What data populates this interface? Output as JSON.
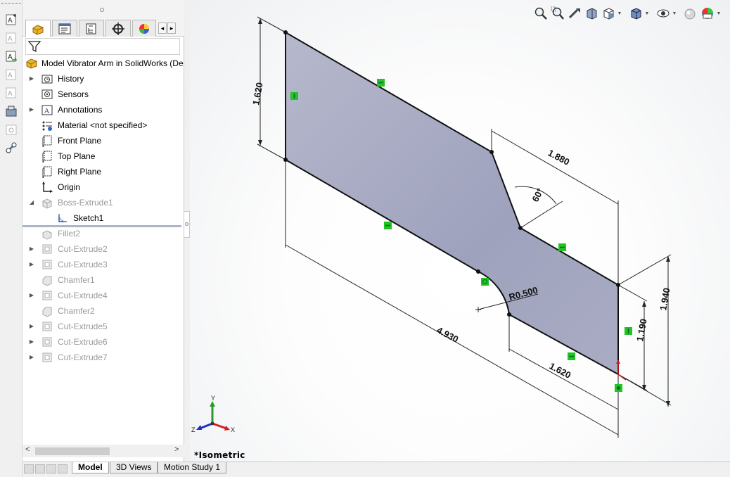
{
  "feature_tree": {
    "filter_icon": "filter-icon",
    "root_label": "Model Vibrator Arm in SolidWorks  (De",
    "items": [
      {
        "label": "History",
        "icon": "history-folder-icon",
        "expandable": true,
        "greyed": false
      },
      {
        "label": "Sensors",
        "icon": "sensors-icon",
        "expandable": false,
        "greyed": false
      },
      {
        "label": "Annotations",
        "icon": "annotations-icon",
        "expandable": true,
        "greyed": false
      },
      {
        "label": "Material <not specified>",
        "icon": "material-icon",
        "expandable": false,
        "greyed": false
      },
      {
        "label": "Front Plane",
        "icon": "plane-icon",
        "expandable": false,
        "greyed": false
      },
      {
        "label": "Top Plane",
        "icon": "plane-icon",
        "expandable": false,
        "greyed": false
      },
      {
        "label": "Right Plane",
        "icon": "plane-icon",
        "expandable": false,
        "greyed": false
      },
      {
        "label": "Origin",
        "icon": "origin-icon",
        "expandable": false,
        "greyed": false
      },
      {
        "label": "Boss-Extrude1",
        "icon": "boss-extrude-icon",
        "expandable": true,
        "expanded": true,
        "greyed": true
      },
      {
        "label": "Sketch1",
        "icon": "sketch-icon",
        "expandable": false,
        "greyed": false,
        "child": true
      },
      {
        "label": "Fillet2",
        "icon": "fillet-icon",
        "expandable": false,
        "greyed": true
      },
      {
        "label": "Cut-Extrude2",
        "icon": "cut-extrude-icon",
        "expandable": true,
        "greyed": true
      },
      {
        "label": "Cut-Extrude3",
        "icon": "cut-extrude-icon",
        "expandable": true,
        "greyed": true
      },
      {
        "label": "Chamfer1",
        "icon": "chamfer-icon",
        "expandable": false,
        "greyed": true
      },
      {
        "label": "Cut-Extrude4",
        "icon": "cut-extrude-icon",
        "expandable": true,
        "greyed": true
      },
      {
        "label": "Chamfer2",
        "icon": "chamfer-icon",
        "expandable": false,
        "greyed": true
      },
      {
        "label": "Cut-Extrude5",
        "icon": "cut-extrude-icon",
        "expandable": true,
        "greyed": true
      },
      {
        "label": "Cut-Extrude6",
        "icon": "cut-extrude-icon",
        "expandable": true,
        "greyed": true
      },
      {
        "label": "Cut-Extrude7",
        "icon": "cut-extrude-icon",
        "expandable": true,
        "greyed": true
      }
    ]
  },
  "panel_tabs": [
    {
      "name": "featuremanager-tab",
      "icon": "feature-manager-icon",
      "active": true
    },
    {
      "name": "propertymanager-tab",
      "icon": "property-manager-icon",
      "active": false
    },
    {
      "name": "configurationmanager-tab",
      "icon": "configuration-manager-icon",
      "active": false
    },
    {
      "name": "dimxpert-tab",
      "icon": "dimxpert-icon",
      "active": false
    },
    {
      "name": "display-manager-tab",
      "icon": "display-manager-icon",
      "active": false
    }
  ],
  "bottom_tabs": {
    "model": "Model",
    "views_3d": "3D Views",
    "motion_study": "Motion Study 1"
  },
  "viewport": {
    "view_label": "*Isometric",
    "sketch_fill": "#a6a9c2",
    "relation_color": "#22c322",
    "dimensions": {
      "d1": "1.620",
      "d2": "1.880",
      "angle": "60°",
      "radius": "R0.500",
      "d3": "4.930",
      "d4": "1.620",
      "d5": "1.190",
      "d6": "1.940"
    },
    "triad": {
      "x": "X",
      "y": "Y",
      "z": "Z"
    }
  },
  "heads_up_toolbar": [
    "zoom-to-fit-icon",
    "zoom-to-area-icon",
    "previous-view-icon",
    "section-view-icon",
    "view-orientation-icon",
    "display-style-icon",
    "hide-show-items-icon",
    "edit-appearance-icon",
    "apply-scene-icon"
  ],
  "left_strip": [
    "smart-dimension-icon",
    "note-icon",
    "auto-dimension-icon",
    "balloon-icon",
    "datum-icon",
    "toolbox-icon",
    "hole-callout-icon",
    "sketch-tools-icon"
  ]
}
